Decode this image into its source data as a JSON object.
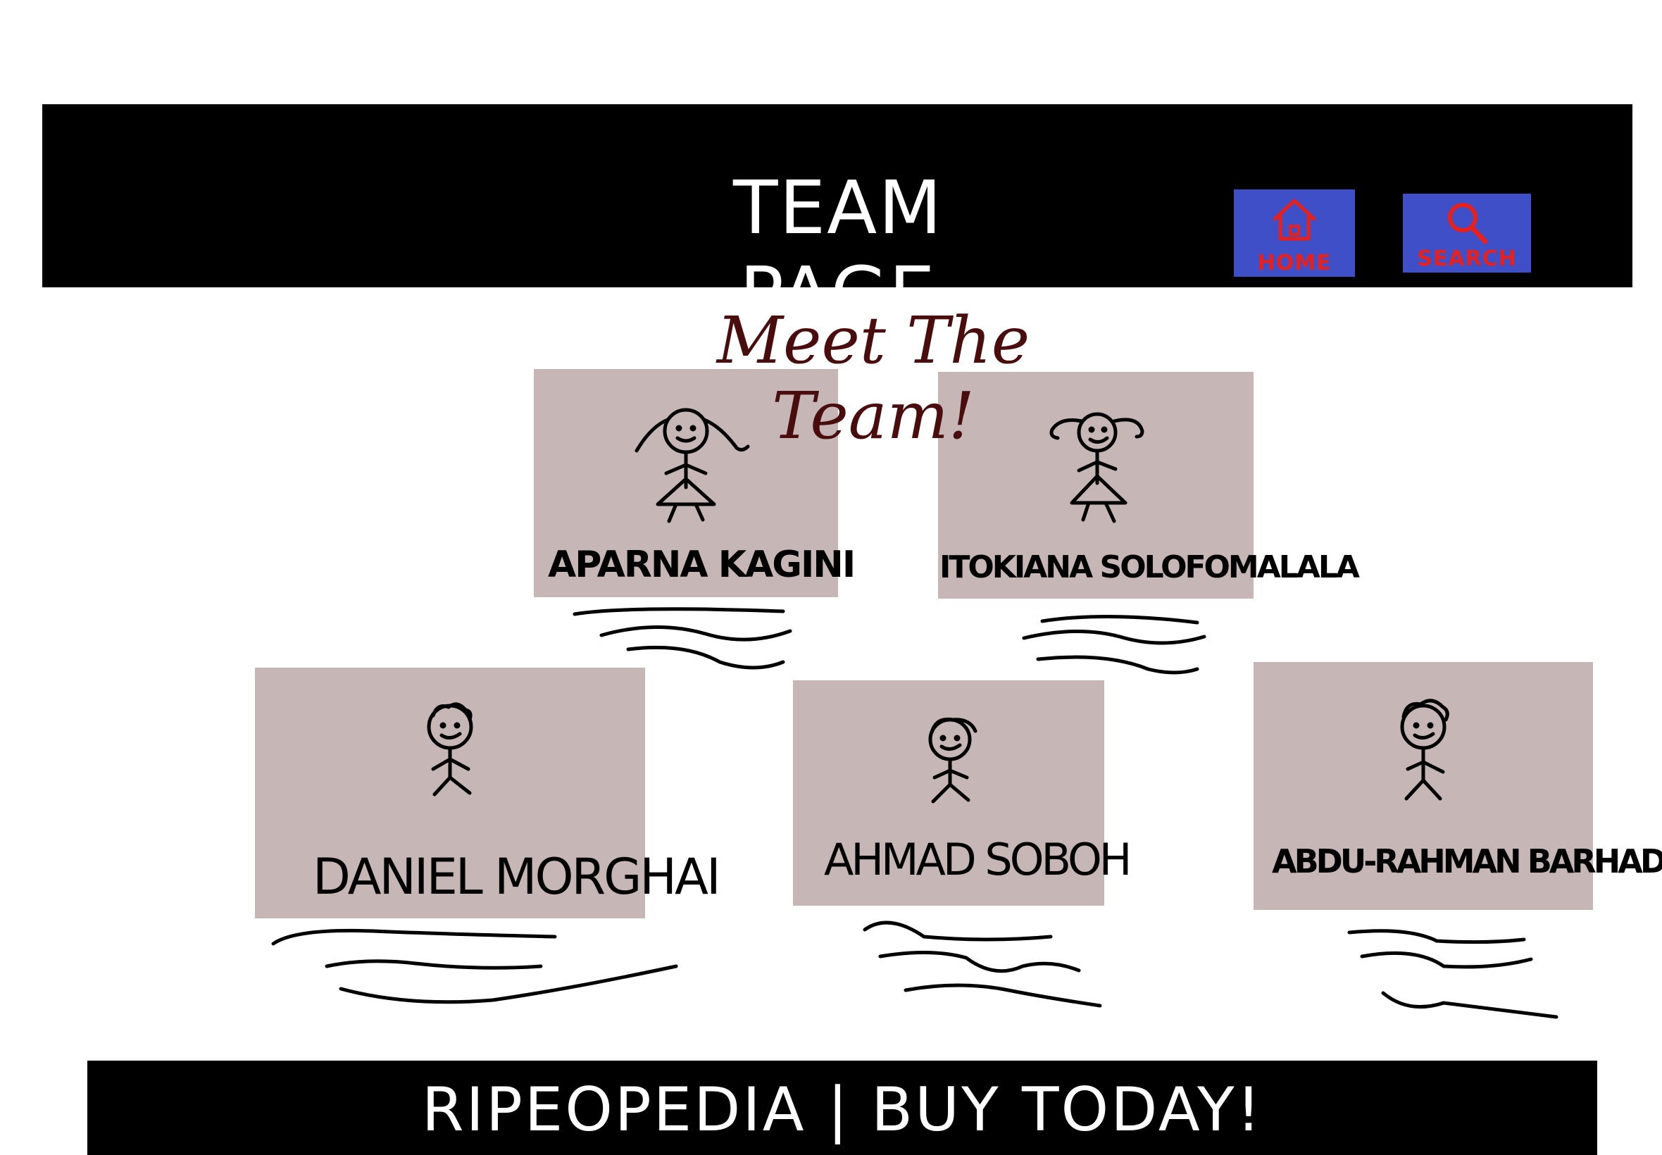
{
  "header": {
    "title": "TEAM PAGE",
    "nav": {
      "home_label": "HOME",
      "search_label": "SEARCH"
    }
  },
  "heading": "Meet The Team!",
  "team": [
    {
      "name": "APARNA KAGINI"
    },
    {
      "name": "ITOKIANA SOLOFOMALALA"
    },
    {
      "name": "DANIEL MORGHAI"
    },
    {
      "name": "AHMAD SOBOH"
    },
    {
      "name": "ABDU-RAHMAN BARHAD"
    }
  ],
  "footer": {
    "text": "RIPEOPEDIA | BUY TODAY!"
  },
  "colors": {
    "header_bg": "#000000",
    "nav_button_bg": "#3f4fc8",
    "nav_label": "#e8201c",
    "heading": "#4a0d0d",
    "card_bg": "#c6b6b6"
  }
}
